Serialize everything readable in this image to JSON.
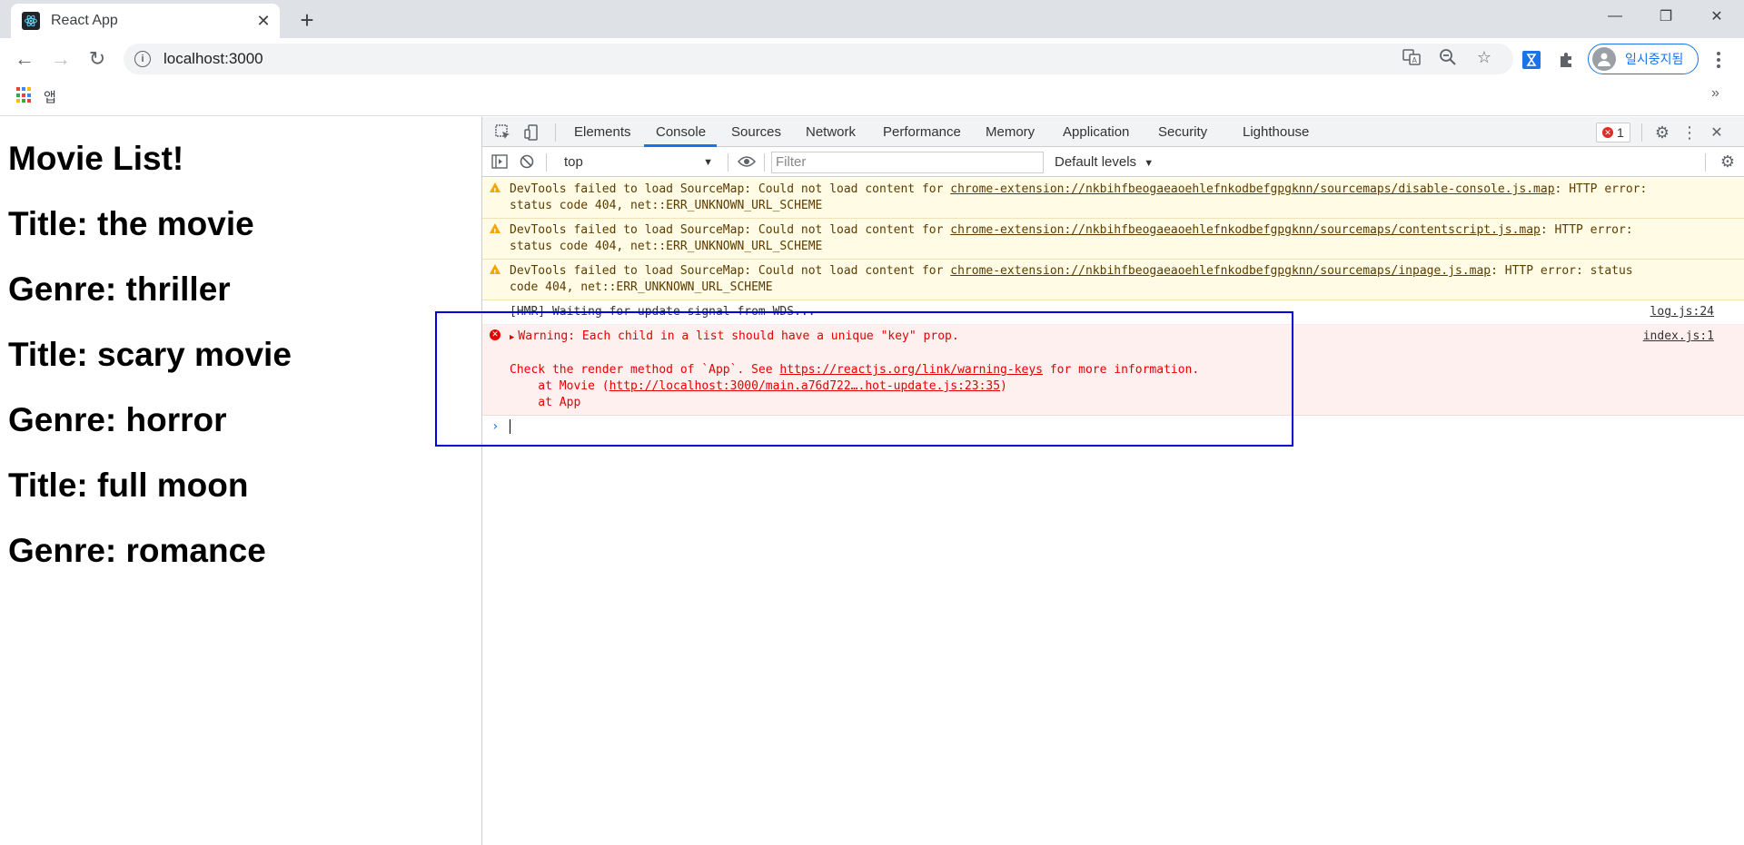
{
  "browser": {
    "tab_title": "React App",
    "url": "localhost:3000",
    "profile_label": "일시중지됨",
    "bookmarks_apps_label": "앱",
    "bookmarks_more": "»"
  },
  "page": {
    "heading": "Movie List!",
    "lines": [
      "Title: the movie",
      "Genre: thriller",
      "Title: scary movie",
      "Genre: horror",
      "Title: full moon",
      "Genre: romance"
    ]
  },
  "devtools": {
    "tabs": [
      "Elements",
      "Console",
      "Sources",
      "Network",
      "Performance",
      "Memory",
      "Application",
      "Security",
      "Lighthouse"
    ],
    "active_tab": "Console",
    "error_count": "1",
    "context": "top",
    "filter_placeholder": "Filter",
    "levels": "Default levels",
    "messages": {
      "warn1_text": "DevTools failed to load SourceMap: Could not load content for ",
      "warn1_link": "chrome-extension://nkbihfbeogaeaoehlefnkodbefgpgknn/sourcemaps/disable-console.js.map",
      "warn1_tail": ": HTTP error:",
      "warn1_line2": "status code 404, net::ERR_UNKNOWN_URL_SCHEME",
      "warn2_text": "DevTools failed to load SourceMap: Could not load content for ",
      "warn2_link": "chrome-extension://nkbihfbeogaeaoehlefnkodbefgpgknn/sourcemaps/contentscript.js.map",
      "warn2_tail": ": HTTP error:",
      "warn2_line2": "status code 404, net::ERR_UNKNOWN_URL_SCHEME",
      "warn3_text": "DevTools failed to load SourceMap: Could not load content for ",
      "warn3_link": "chrome-extension://nkbihfbeogaeaoehlefnkodbefgpgknn/sourcemaps/inpage.js.map",
      "warn3_tail": ": HTTP error: status",
      "warn3_line2": "code 404, net::ERR_UNKNOWN_URL_SCHEME",
      "log_text": "[HMR] Waiting for update signal from WDS...",
      "log_src": "log.js:24",
      "err_line1": "Warning: Each child in a list should have a unique \"key\" prop.",
      "err_src": "index.js:1",
      "err_line2a": "Check the render method of `App`. See ",
      "err_line2_link": "https://reactjs.org/link/warning-keys",
      "err_line2b": " for more information.",
      "err_line3a": "    at Movie (",
      "err_line3_link": "http://localhost:3000/main.a76d722….hot-update.js:23:35",
      "err_line3b": ")",
      "err_line4": "    at App"
    }
  },
  "colors": {
    "accent": "#1a73e8",
    "warning_bg": "#fffbe5",
    "error_bg": "#fff0f0",
    "error_text": "#e50000",
    "highlight_box": "#0000dd"
  }
}
